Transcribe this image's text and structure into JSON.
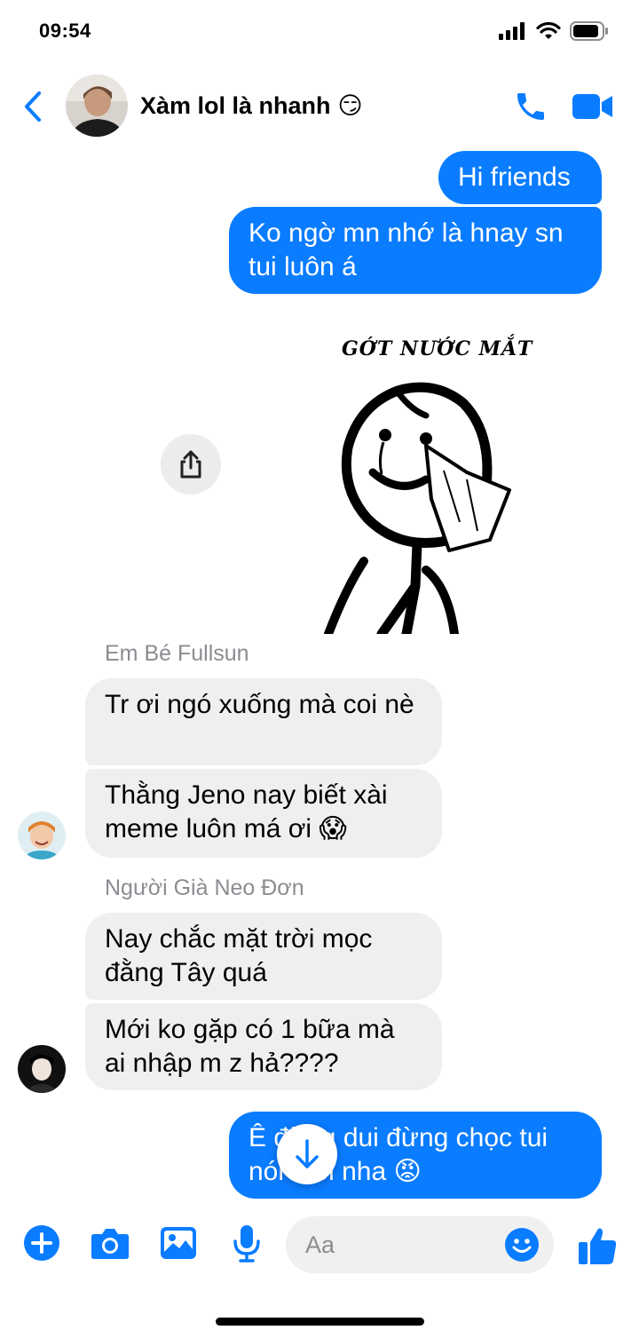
{
  "status_bar": {
    "time": "09:54"
  },
  "header": {
    "title": "Xàm lol là nhanh",
    "title_emoji": "😏",
    "accent_color": "#0a7cff"
  },
  "messages": [
    {
      "direction": "out",
      "text": "Hi friends"
    },
    {
      "direction": "out",
      "text": "Ko ngờ mn nhớ là hnay sn tui luôn á"
    },
    {
      "direction": "out",
      "type": "image",
      "caption": "GỚT NƯỚC MẮT"
    },
    {
      "direction": "in",
      "sender": "Em Bé Fullsun",
      "text": "Tr ơi ngó xuống mà coi nè"
    },
    {
      "direction": "in",
      "text": "Thằng Jeno nay biết xài meme luôn má ơi 😱"
    },
    {
      "direction": "in",
      "sender": "Người Già Neo Đơn",
      "text": "Nay chắc mặt trời mọc đằng Tây quá"
    },
    {
      "direction": "in",
      "text": "Mới ko gặp có 1 bữa mà ai nhập m z hả????"
    },
    {
      "direction": "out",
      "text": "Ê đừng dui đừng chọc tui nói thôi nha 😡"
    }
  ],
  "composer": {
    "placeholder": "Aa"
  },
  "icons": {
    "back": "chevron-left-icon",
    "call": "phone-icon",
    "video": "video-camera-icon",
    "share": "share-icon",
    "scroll": "arrow-down-icon",
    "plus": "plus-icon",
    "camera": "camera-icon",
    "gallery": "photo-icon",
    "mic": "microphone-icon",
    "emoji": "smiley-icon",
    "like": "thumbs-up-icon"
  }
}
